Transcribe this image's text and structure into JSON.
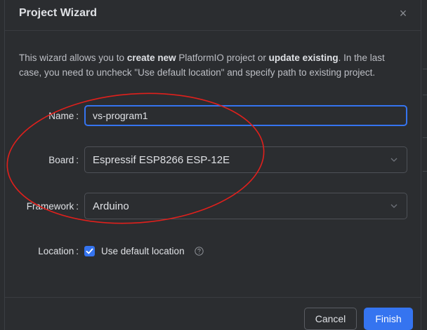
{
  "dialog": {
    "title": "Project Wizard",
    "close_glyph": "×"
  },
  "description": {
    "part1": "This wizard allows you to ",
    "bold1": "create new",
    "part2": " PlatformIO project or ",
    "bold2": "update existing",
    "part3": ". In the last case, you need to uncheck \"Use default location\" and specify path to existing project."
  },
  "form": {
    "name": {
      "label": "Name",
      "value": "vs-program1"
    },
    "board": {
      "label": "Board",
      "value": "Espressif ESP8266 ESP-12E"
    },
    "framework": {
      "label": "Framework",
      "value": "Arduino"
    },
    "location": {
      "label": "Location",
      "checkbox_label": "Use default location",
      "checked": true
    }
  },
  "colon": ":",
  "footer": {
    "cancel_label": "Cancel",
    "finish_label": "Finish"
  },
  "colors": {
    "accent": "#3574f0",
    "annotation": "#e0201c"
  }
}
